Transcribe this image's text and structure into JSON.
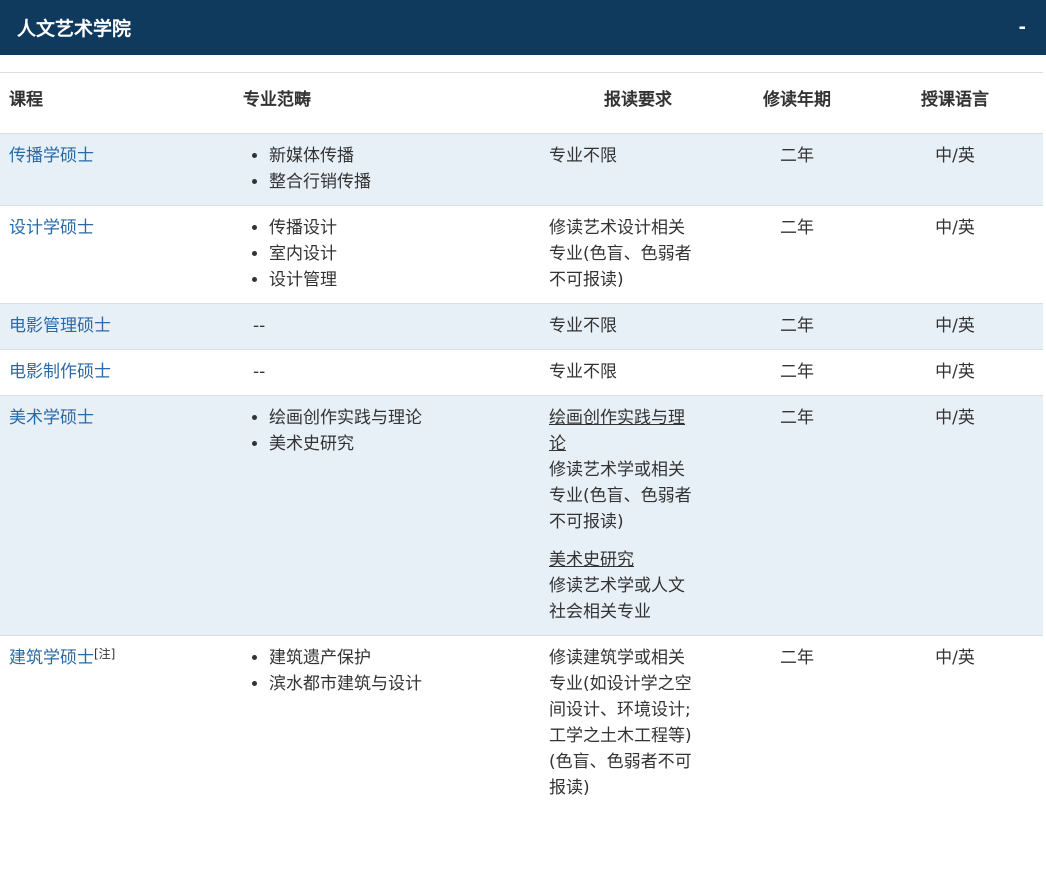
{
  "header": {
    "title": "人文艺术学院",
    "toggle_label": "-"
  },
  "columns": [
    "课程",
    "专业范畴",
    "报读要求",
    "修读年期",
    "授课语言"
  ],
  "rows": [
    {
      "course": "传播学硕士",
      "majors": [
        "新媒体传播",
        "整合行销传播"
      ],
      "requirements": [
        {
          "heading": "",
          "text": "专业不限"
        }
      ],
      "duration": "二年",
      "language": "中/英"
    },
    {
      "course": "设计学硕士",
      "majors": [
        "传播设计",
        "室内设计",
        "设计管理"
      ],
      "requirements": [
        {
          "heading": "",
          "text": "修读艺术设计相关\n专业(色盲、色弱者\n不可报读)"
        }
      ],
      "duration": "二年",
      "language": "中/英"
    },
    {
      "course": "电影管理硕士",
      "majors_text": "--",
      "requirements": [
        {
          "heading": "",
          "text": "专业不限"
        }
      ],
      "duration": "二年",
      "language": "中/英"
    },
    {
      "course": "电影制作硕士",
      "majors_text": "--",
      "requirements": [
        {
          "heading": "",
          "text": "专业不限"
        }
      ],
      "duration": "二年",
      "language": "中/英"
    },
    {
      "course": "美术学硕士",
      "majors": [
        "绘画创作实践与理论",
        "美术史研究"
      ],
      "requirements": [
        {
          "heading": "绘画创作实践与理\n论",
          "text": "修读艺术学或相关\n专业(色盲、色弱者\n不可报读)"
        },
        {
          "heading": "美术史研究",
          "text": "修读艺术学或人文\n社会相关专业"
        }
      ],
      "duration": "二年",
      "language": "中/英"
    },
    {
      "course": "建筑学硕士",
      "note": "[注]",
      "majors": [
        "建筑遗产保护",
        "滨水都市建筑与设计"
      ],
      "requirements": [
        {
          "heading": "",
          "text": "修读建筑学或相关\n专业(如设计学之空\n间设计、环境设计;\n工学之土木工程等)\n(色盲、色弱者不可\n报读)"
        }
      ],
      "duration": "二年",
      "language": "中/英"
    }
  ]
}
